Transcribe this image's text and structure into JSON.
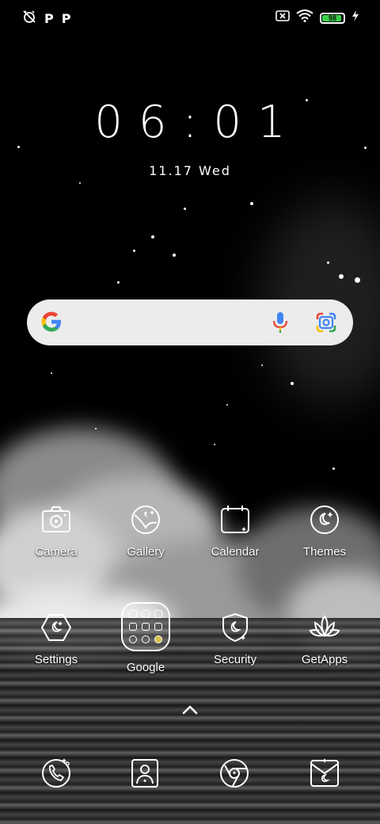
{
  "status_bar": {
    "left_icons": [
      "alarm-off-icon",
      "p-icon",
      "p-icon"
    ],
    "p_glyph": "P",
    "right_icons": [
      "sim-x-icon",
      "wifi-icon",
      "battery-icon",
      "charging-icon"
    ],
    "battery_level": "98",
    "battery_color": "#3ad14a"
  },
  "clock": {
    "time": "06:01",
    "date": "11.17 Wed"
  },
  "search": {
    "icons": [
      "google-g-icon",
      "microphone-icon",
      "google-lens-icon"
    ]
  },
  "apps": [
    {
      "label": "Camera",
      "icon": "camera-icon"
    },
    {
      "label": "Gallery",
      "icon": "gallery-icon"
    },
    {
      "label": "Calendar",
      "icon": "calendar-icon"
    },
    {
      "label": "Themes",
      "icon": "themes-icon"
    },
    {
      "label": "Settings",
      "icon": "settings-icon"
    },
    {
      "label": "Google",
      "icon": "folder-icon"
    },
    {
      "label": "Security",
      "icon": "security-shield-icon"
    },
    {
      "label": "GetApps",
      "icon": "lotus-icon"
    }
  ],
  "app_drawer": {
    "icon": "chevron-up-icon"
  },
  "dock": [
    {
      "icon": "phone-icon"
    },
    {
      "icon": "contacts-icon"
    },
    {
      "icon": "chrome-icon"
    },
    {
      "icon": "messages-icon"
    }
  ]
}
